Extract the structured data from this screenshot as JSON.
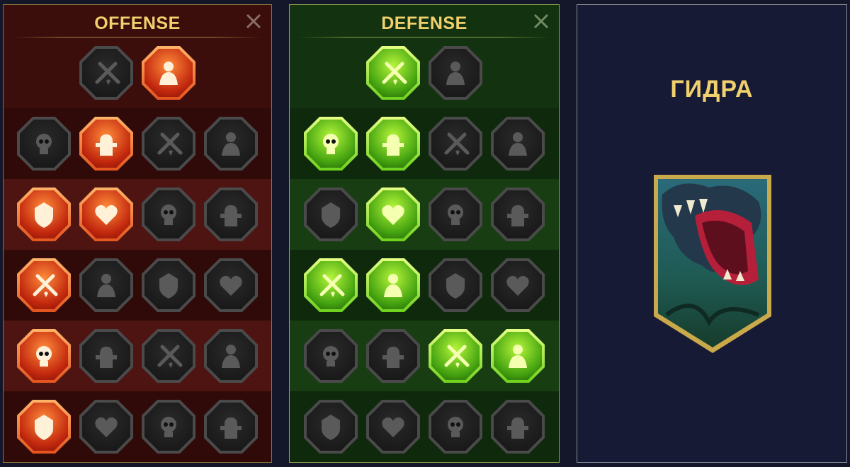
{
  "offense": {
    "title": "OFFENSE",
    "rows": [
      [
        "crossed-swords-icon",
        "sword-strike-icon"
      ],
      [
        "demon-icon",
        "slash-icon",
        "shield-break-icon",
        "heart-crack-icon"
      ],
      [
        "arrows-body-icon",
        "fangs-icon",
        "skull-wind-icon",
        "scythe-icon"
      ],
      [
        "bleeding-heart-icon",
        "fist-icon",
        "axe-icon",
        "chain-lightning-icon"
      ],
      [
        "arrows-explosion-icon",
        "twin-skulls-icon",
        "dagger-circle-icon",
        "brute-icon"
      ],
      [
        "sparkling-sword-icon",
        "knight-helmet-icon",
        "ogre-icon",
        "mohawk-skull-icon"
      ]
    ],
    "active": [
      [
        false,
        true
      ],
      [
        false,
        true,
        false,
        false
      ],
      [
        true,
        true,
        false,
        false
      ],
      [
        true,
        false,
        false,
        false
      ],
      [
        true,
        false,
        false,
        false
      ],
      [
        true,
        false,
        false,
        false
      ]
    ]
  },
  "defense": {
    "title": "DEFENSE",
    "rows": [
      [
        "bricks-icon",
        "raised-fist-icon"
      ],
      [
        "chevron-shield-icon",
        "anatomical-heart-icon",
        "titan-icon",
        "crossed-blades-icon"
      ],
      [
        "figures-icon",
        "knight-shield-icon",
        "skull-heart-icon",
        "hooded-figure-icon"
      ],
      [
        "crowd-icon",
        "hourglass-skull-icon",
        "open-hand-icon",
        "bull-icon"
      ],
      [
        "running-shield-icon",
        "flames-icon",
        "radiant-skull-icon",
        "grasping-hand-icon"
      ],
      [
        "spiked-warrior-icon",
        "winged-shield-icon",
        "bearded-head-icon",
        "strongman-icon"
      ]
    ],
    "active": [
      [
        true,
        false
      ],
      [
        true,
        true,
        false,
        false
      ],
      [
        false,
        true,
        false,
        false
      ],
      [
        true,
        true,
        false,
        false
      ],
      [
        false,
        false,
        true,
        true
      ],
      [
        false,
        false,
        false,
        false
      ]
    ]
  },
  "hero": {
    "name": "ГИДРА",
    "portrait_icon": "hydra-portrait-icon"
  },
  "colors": {
    "title_gold": "#f1d16e",
    "offense_active": "#e3541f",
    "defense_active": "#6ed21d"
  }
}
